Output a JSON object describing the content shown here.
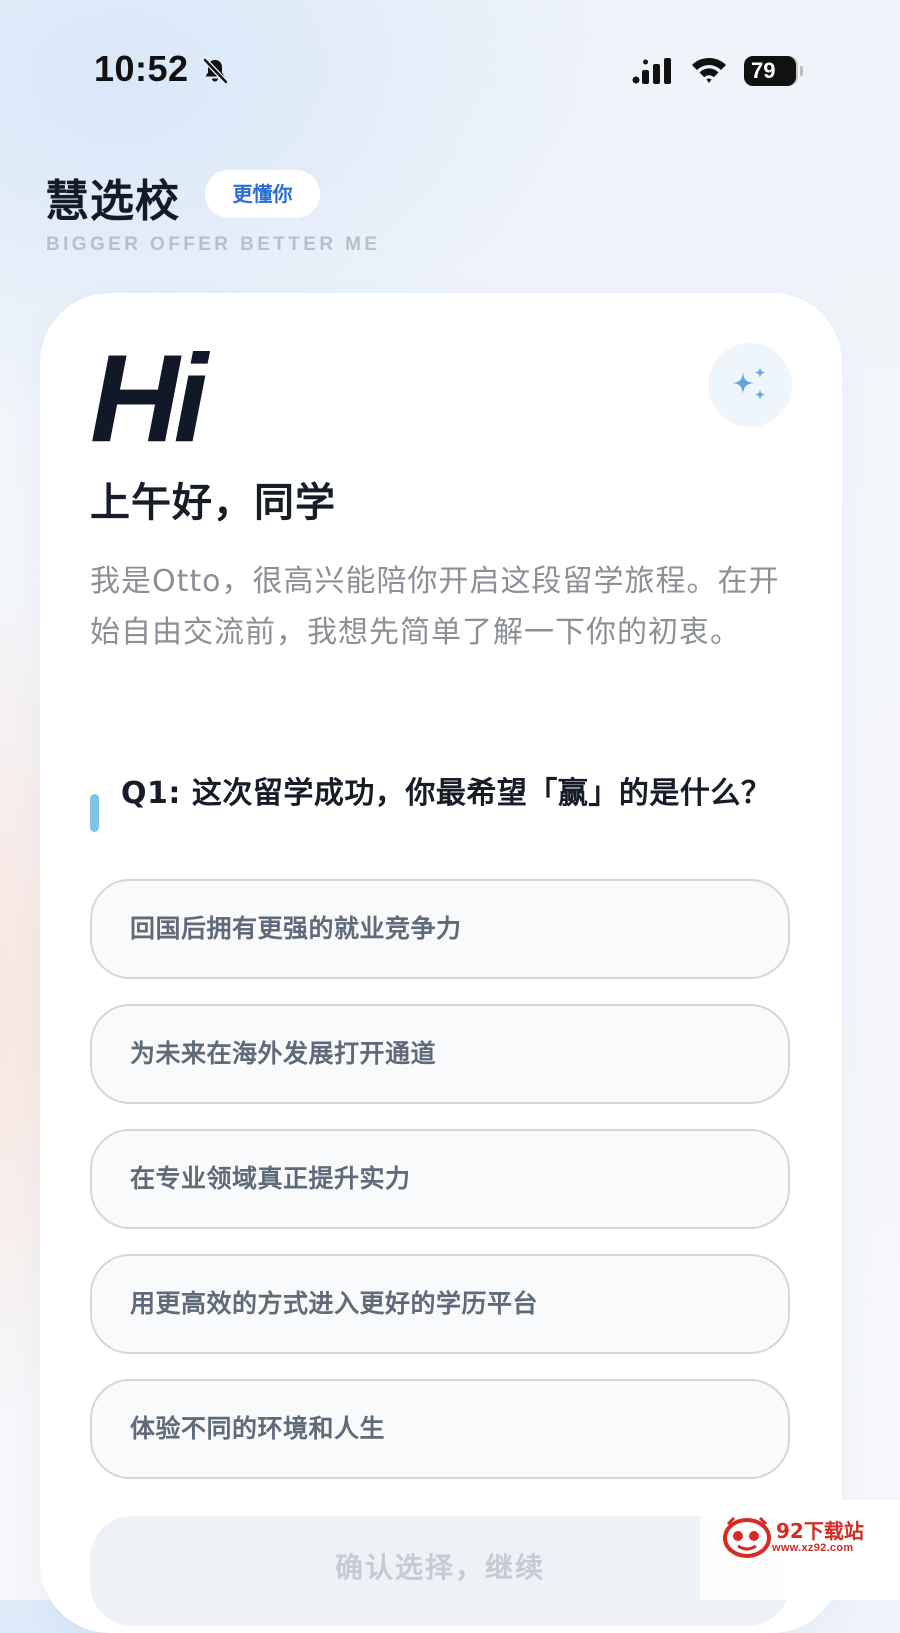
{
  "status_bar": {
    "time": "10:52",
    "battery_level": "79",
    "icons": [
      "bell-slash-icon",
      "cellular-signal-icon",
      "wifi-icon",
      "battery-icon"
    ]
  },
  "header": {
    "app_name": "慧选校",
    "badge": "更懂你",
    "tagline": "BIGGER OFFER BETTER ME"
  },
  "card": {
    "logo_text": "Hi",
    "assistant_icon": "sparkle-icon",
    "greeting": "上午好，同学",
    "intro": "我是Otto，很高兴能陪你开启这段留学旅程。在开始自由交流前，我想先简单了解一下你的初衷。"
  },
  "question": {
    "text": "Q1: 这次留学成功，你最希望「赢」的是什么？",
    "options": [
      {
        "label": "回国后拥有更强的就业竞争力"
      },
      {
        "label": "为未来在海外发展打开通道"
      },
      {
        "label": "在专业领域真正提升实力"
      },
      {
        "label": "用更高效的方式进入更好的学历平台"
      },
      {
        "label": "体验不同的环境和人生"
      }
    ]
  },
  "confirm": {
    "label": "确认选择，继续"
  },
  "watermark": {
    "title": "92下载站",
    "url": "www.xz92.com"
  },
  "colors": {
    "accent_blue": "#2b6fd6",
    "question_bar": "#7fc3e6",
    "option_border": "#d4d6da",
    "watermark_red": "#d52b23"
  }
}
